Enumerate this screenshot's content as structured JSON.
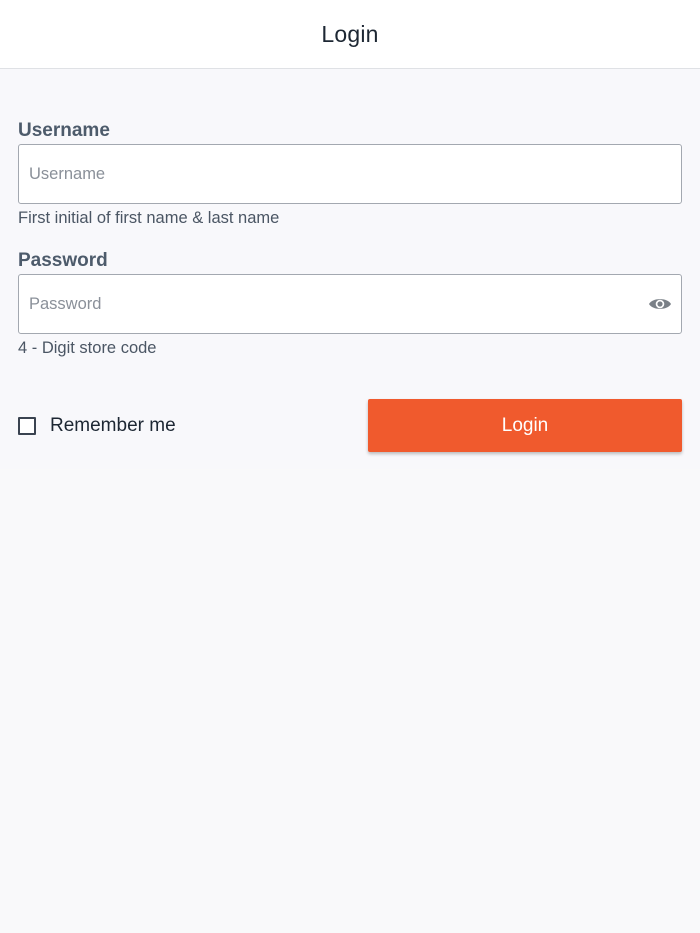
{
  "header": {
    "title": "Login"
  },
  "form": {
    "username": {
      "label": "Username",
      "placeholder": "Username",
      "value": "",
      "helper": "First initial of first name & last name"
    },
    "password": {
      "label": "Password",
      "placeholder": "Password",
      "value": "",
      "helper": "4 - Digit store code",
      "toggle_icon": "eye-icon"
    },
    "remember": {
      "label": "Remember me",
      "checked": false
    },
    "submit": {
      "label": "Login"
    }
  },
  "colors": {
    "accent": "#f05a2d",
    "header_bg": "#ffffff",
    "page_bg": "#f9f9fa",
    "label_text": "#4d5b6b",
    "body_text": "#1d2733"
  }
}
